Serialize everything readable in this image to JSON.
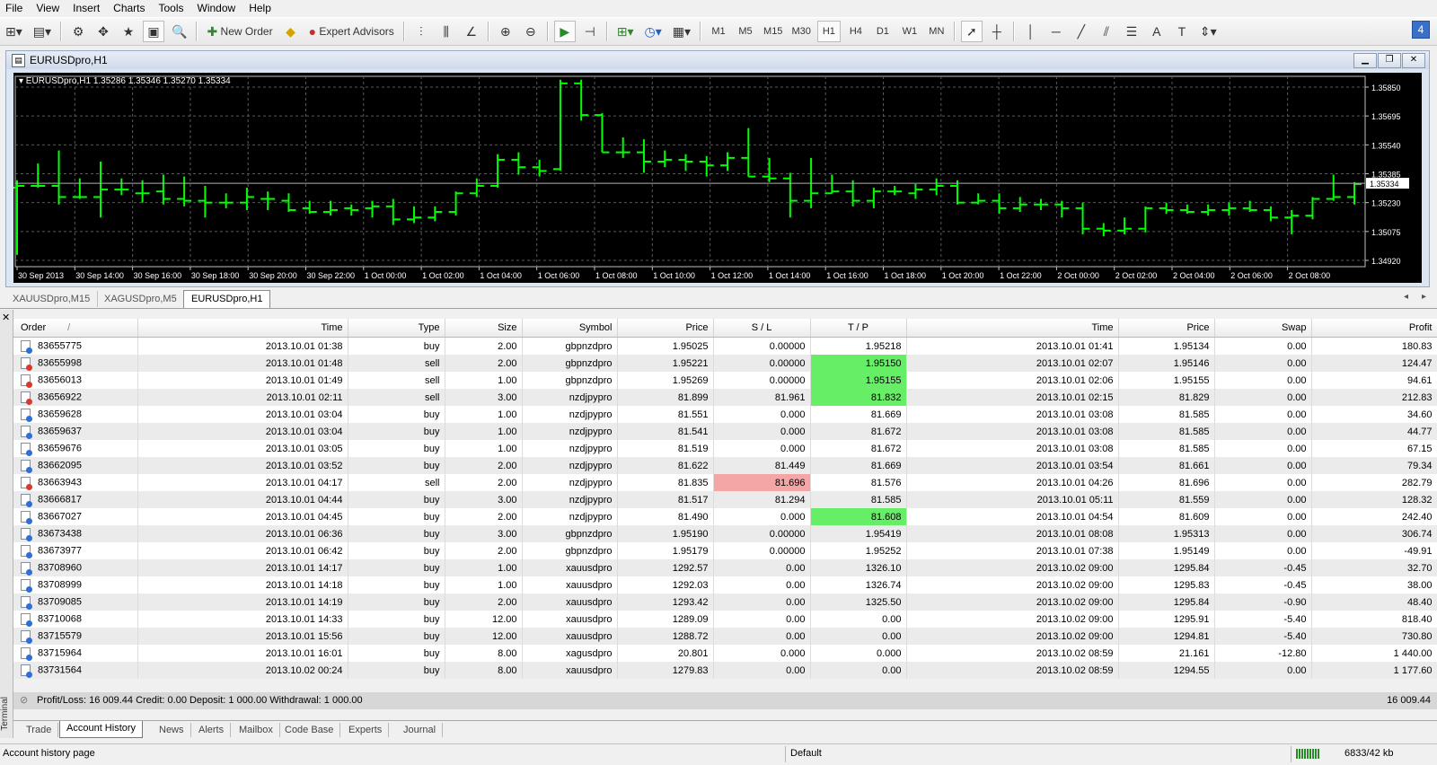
{
  "menu": [
    "File",
    "View",
    "Insert",
    "Charts",
    "Tools",
    "Window",
    "Help"
  ],
  "toolbar": {
    "new_order": "New Order",
    "expert_advisors": "Expert Advisors",
    "timeframes": [
      "M1",
      "M5",
      "M15",
      "M30",
      "H1",
      "H4",
      "D1",
      "W1",
      "MN"
    ],
    "active_timeframe": "H1"
  },
  "chart_window": {
    "title": "EURUSDpro,H1",
    "info": "EURUSDpro,H1  1.35286 1.35346 1.35270 1.35334",
    "current_price_label": "1.35334"
  },
  "chart_data": {
    "type": "bar",
    "ylim": [
      1.3492,
      1.3591
    ],
    "yticks": [
      "1.35850",
      "1.35695",
      "1.35540",
      "1.35385",
      "1.35230",
      "1.35075",
      "1.34920"
    ],
    "ytick_values": [
      1.3585,
      1.35695,
      1.3554,
      1.35385,
      1.3523,
      1.35075,
      1.3492
    ],
    "xticks": [
      "30 Sep 2013",
      "30 Sep 14:00",
      "30 Sep 16:00",
      "30 Sep 18:00",
      "30 Sep 20:00",
      "30 Sep 22:00",
      "1 Oct 00:00",
      "1 Oct 02:00",
      "1 Oct 04:00",
      "1 Oct 06:00",
      "1 Oct 08:00",
      "1 Oct 10:00",
      "1 Oct 12:00",
      "1 Oct 14:00",
      "1 Oct 16:00",
      "1 Oct 18:00",
      "1 Oct 20:00",
      "1 Oct 22:00",
      "2 Oct 00:00",
      "2 Oct 02:00",
      "2 Oct 04:00",
      "2 Oct 06:00",
      "2 Oct 08:00"
    ],
    "current_price": 1.35334,
    "ohlc": [
      [
        1.3531,
        1.3535,
        1.3495,
        1.3532
      ],
      [
        1.3532,
        1.3544,
        1.3531,
        1.3532
      ],
      [
        1.3532,
        1.3551,
        1.3522,
        1.3526
      ],
      [
        1.3526,
        1.3536,
        1.3525,
        1.3526
      ],
      [
        1.3526,
        1.3545,
        1.3515,
        1.353
      ],
      [
        1.353,
        1.3536,
        1.3527,
        1.353
      ],
      [
        1.3528,
        1.3535,
        1.3523,
        1.3528
      ],
      [
        1.3529,
        1.3538,
        1.3522,
        1.3525
      ],
      [
        1.3525,
        1.3537,
        1.3521,
        1.3524
      ],
      [
        1.3524,
        1.3532,
        1.3515,
        1.3523
      ],
      [
        1.3523,
        1.3528,
        1.352,
        1.3523
      ],
      [
        1.3523,
        1.3531,
        1.3519,
        1.3526
      ],
      [
        1.3525,
        1.3529,
        1.3519,
        1.3525
      ],
      [
        1.3524,
        1.3528,
        1.3518,
        1.3519
      ],
      [
        1.352,
        1.3524,
        1.3517,
        1.3518
      ],
      [
        1.3518,
        1.3524,
        1.3516,
        1.3519
      ],
      [
        1.352,
        1.3522,
        1.3516,
        1.3519
      ],
      [
        1.352,
        1.3524,
        1.3515,
        1.3521
      ],
      [
        1.3521,
        1.3525,
        1.3511,
        1.3514
      ],
      [
        1.3514,
        1.3521,
        1.3512,
        1.3515
      ],
      [
        1.3515,
        1.3521,
        1.3513,
        1.3518
      ],
      [
        1.3518,
        1.3529,
        1.3516,
        1.3528
      ],
      [
        1.3528,
        1.3536,
        1.3526,
        1.3532
      ],
      [
        1.3532,
        1.3549,
        1.3531,
        1.3546
      ],
      [
        1.3546,
        1.355,
        1.3538,
        1.3542
      ],
      [
        1.3542,
        1.3546,
        1.3537,
        1.354
      ],
      [
        1.3541,
        1.3589,
        1.354,
        1.3587
      ],
      [
        1.3587,
        1.3589,
        1.3567,
        1.357
      ],
      [
        1.357,
        1.3571,
        1.355,
        1.355
      ],
      [
        1.355,
        1.3558,
        1.3547,
        1.355
      ],
      [
        1.355,
        1.3557,
        1.3539,
        1.3545
      ],
      [
        1.3545,
        1.3551,
        1.3542,
        1.3546
      ],
      [
        1.3546,
        1.3549,
        1.354,
        1.3545
      ],
      [
        1.3545,
        1.3548,
        1.3537,
        1.3543
      ],
      [
        1.3543,
        1.355,
        1.354,
        1.3547
      ],
      [
        1.3547,
        1.3563,
        1.3537,
        1.3537
      ],
      [
        1.3537,
        1.3547,
        1.3534,
        1.3536
      ],
      [
        1.3536,
        1.3539,
        1.3515,
        1.3524
      ],
      [
        1.3524,
        1.3547,
        1.352,
        1.3528
      ],
      [
        1.3528,
        1.3538,
        1.3528,
        1.3529
      ],
      [
        1.3529,
        1.3535,
        1.3521,
        1.3524
      ],
      [
        1.3524,
        1.3531,
        1.352,
        1.3529
      ],
      [
        1.3529,
        1.3532,
        1.3527,
        1.3529
      ],
      [
        1.3528,
        1.3533,
        1.3525,
        1.353
      ],
      [
        1.353,
        1.3536,
        1.3527,
        1.3532
      ],
      [
        1.3532,
        1.3535,
        1.3522,
        1.3523
      ],
      [
        1.3523,
        1.3528,
        1.3522,
        1.3524
      ],
      [
        1.3524,
        1.3528,
        1.3517,
        1.352
      ],
      [
        1.352,
        1.3526,
        1.3518,
        1.3522
      ],
      [
        1.3522,
        1.3525,
        1.3519,
        1.3522
      ],
      [
        1.3522,
        1.3524,
        1.3515,
        1.352
      ],
      [
        1.352,
        1.3523,
        1.3506,
        1.3509
      ],
      [
        1.3509,
        1.3512,
        1.3505,
        1.3508
      ],
      [
        1.3508,
        1.3515,
        1.3506,
        1.3509
      ],
      [
        1.3509,
        1.3521,
        1.3507,
        1.352
      ],
      [
        1.352,
        1.3523,
        1.3517,
        1.3519
      ],
      [
        1.3519,
        1.3522,
        1.3517,
        1.3518
      ],
      [
        1.3518,
        1.3522,
        1.3516,
        1.3519
      ],
      [
        1.3519,
        1.3523,
        1.3516,
        1.352
      ],
      [
        1.352,
        1.3524,
        1.3518,
        1.3519
      ],
      [
        1.3519,
        1.3521,
        1.3513,
        1.3515
      ],
      [
        1.3515,
        1.3519,
        1.3506,
        1.3516
      ],
      [
        1.3516,
        1.3526,
        1.3514,
        1.3525
      ],
      [
        1.3525,
        1.3538,
        1.3524,
        1.3526
      ],
      [
        1.3526,
        1.3534,
        1.3522,
        1.3533
      ]
    ]
  },
  "chart_tabs": [
    "XAUUSDpro,M15",
    "XAGUSDpro,M5",
    "EURUSDpro,H1"
  ],
  "selected_chart_tab": "EURUSDpro,H1",
  "terminal": {
    "side_label": "Terminal",
    "columns": [
      "Order",
      "Time",
      "Type",
      "Size",
      "Symbol",
      "Price",
      "S / L",
      "T / P",
      "Time",
      "Price",
      "Swap",
      "Profit"
    ],
    "sort_mark": "/",
    "rows": [
      {
        "type_icon": "buy",
        "cells": [
          "83655775",
          "2013.10.01 01:38",
          "buy",
          "2.00",
          "gbpnzdpro",
          "1.95025",
          "0.00000",
          "1.95218",
          "2013.10.01 01:41",
          "1.95134",
          "0.00",
          "180.83"
        ],
        "hl": {}
      },
      {
        "type_icon": "sell",
        "cells": [
          "83655998",
          "2013.10.01 01:48",
          "sell",
          "2.00",
          "gbpnzdpro",
          "1.95221",
          "0.00000",
          "1.95150",
          "2013.10.01 02:07",
          "1.95146",
          "0.00",
          "124.47"
        ],
        "hl": {
          "tp": "green"
        }
      },
      {
        "type_icon": "sell",
        "cells": [
          "83656013",
          "2013.10.01 01:49",
          "sell",
          "1.00",
          "gbpnzdpro",
          "1.95269",
          "0.00000",
          "1.95155",
          "2013.10.01 02:06",
          "1.95155",
          "0.00",
          "94.61"
        ],
        "hl": {
          "tp": "green"
        }
      },
      {
        "type_icon": "sell",
        "cells": [
          "83656922",
          "2013.10.01 02:11",
          "sell",
          "3.00",
          "nzdjpypro",
          "81.899",
          "81.961",
          "81.832",
          "2013.10.01 02:15",
          "81.829",
          "0.00",
          "212.83"
        ],
        "hl": {
          "tp": "green"
        }
      },
      {
        "type_icon": "buy",
        "cells": [
          "83659628",
          "2013.10.01 03:04",
          "buy",
          "1.00",
          "nzdjpypro",
          "81.551",
          "0.000",
          "81.669",
          "2013.10.01 03:08",
          "81.585",
          "0.00",
          "34.60"
        ],
        "hl": {}
      },
      {
        "type_icon": "buy",
        "cells": [
          "83659637",
          "2013.10.01 03:04",
          "buy",
          "1.00",
          "nzdjpypro",
          "81.541",
          "0.000",
          "81.672",
          "2013.10.01 03:08",
          "81.585",
          "0.00",
          "44.77"
        ],
        "hl": {}
      },
      {
        "type_icon": "buy",
        "cells": [
          "83659676",
          "2013.10.01 03:05",
          "buy",
          "1.00",
          "nzdjpypro",
          "81.519",
          "0.000",
          "81.672",
          "2013.10.01 03:08",
          "81.585",
          "0.00",
          "67.15"
        ],
        "hl": {}
      },
      {
        "type_icon": "buy",
        "cells": [
          "83662095",
          "2013.10.01 03:52",
          "buy",
          "2.00",
          "nzdjpypro",
          "81.622",
          "81.449",
          "81.669",
          "2013.10.01 03:54",
          "81.661",
          "0.00",
          "79.34"
        ],
        "hl": {}
      },
      {
        "type_icon": "sell",
        "cells": [
          "83663943",
          "2013.10.01 04:17",
          "sell",
          "2.00",
          "nzdjpypro",
          "81.835",
          "81.696",
          "81.576",
          "2013.10.01 04:26",
          "81.696",
          "0.00",
          "282.79"
        ],
        "hl": {
          "sl": "red"
        }
      },
      {
        "type_icon": "buy",
        "cells": [
          "83666817",
          "2013.10.01 04:44",
          "buy",
          "3.00",
          "nzdjpypro",
          "81.517",
          "81.294",
          "81.585",
          "2013.10.01 05:11",
          "81.559",
          "0.00",
          "128.32"
        ],
        "hl": {}
      },
      {
        "type_icon": "buy",
        "cells": [
          "83667027",
          "2013.10.01 04:45",
          "buy",
          "2.00",
          "nzdjpypro",
          "81.490",
          "0.000",
          "81.608",
          "2013.10.01 04:54",
          "81.609",
          "0.00",
          "242.40"
        ],
        "hl": {
          "tp": "green"
        }
      },
      {
        "type_icon": "buy",
        "cells": [
          "83673438",
          "2013.10.01 06:36",
          "buy",
          "3.00",
          "gbpnzdpro",
          "1.95190",
          "0.00000",
          "1.95419",
          "2013.10.01 08:08",
          "1.95313",
          "0.00",
          "306.74"
        ],
        "hl": {}
      },
      {
        "type_icon": "buy",
        "cells": [
          "83673977",
          "2013.10.01 06:42",
          "buy",
          "2.00",
          "gbpnzdpro",
          "1.95179",
          "0.00000",
          "1.95252",
          "2013.10.01 07:38",
          "1.95149",
          "0.00",
          "-49.91"
        ],
        "hl": {}
      },
      {
        "type_icon": "buy",
        "cells": [
          "83708960",
          "2013.10.01 14:17",
          "buy",
          "1.00",
          "xauusdpro",
          "1292.57",
          "0.00",
          "1326.10",
          "2013.10.02 09:00",
          "1295.84",
          "-0.45",
          "32.70"
        ],
        "hl": {}
      },
      {
        "type_icon": "buy",
        "cells": [
          "83708999",
          "2013.10.01 14:18",
          "buy",
          "1.00",
          "xauusdpro",
          "1292.03",
          "0.00",
          "1326.74",
          "2013.10.02 09:00",
          "1295.83",
          "-0.45",
          "38.00"
        ],
        "hl": {}
      },
      {
        "type_icon": "buy",
        "cells": [
          "83709085",
          "2013.10.01 14:19",
          "buy",
          "2.00",
          "xauusdpro",
          "1293.42",
          "0.00",
          "1325.50",
          "2013.10.02 09:00",
          "1295.84",
          "-0.90",
          "48.40"
        ],
        "hl": {}
      },
      {
        "type_icon": "buy",
        "cells": [
          "83710068",
          "2013.10.01 14:33",
          "buy",
          "12.00",
          "xauusdpro",
          "1289.09",
          "0.00",
          "0.00",
          "2013.10.02 09:00",
          "1295.91",
          "-5.40",
          "818.40"
        ],
        "hl": {}
      },
      {
        "type_icon": "buy",
        "cells": [
          "83715579",
          "2013.10.01 15:56",
          "buy",
          "12.00",
          "xauusdpro",
          "1288.72",
          "0.00",
          "0.00",
          "2013.10.02 09:00",
          "1294.81",
          "-5.40",
          "730.80"
        ],
        "hl": {}
      },
      {
        "type_icon": "buy",
        "cells": [
          "83715964",
          "2013.10.01 16:01",
          "buy",
          "8.00",
          "xagusdpro",
          "20.801",
          "0.000",
          "0.000",
          "2013.10.02 08:59",
          "21.161",
          "-12.80",
          "1 440.00"
        ],
        "hl": {}
      },
      {
        "type_icon": "buy",
        "cells": [
          "83731564",
          "2013.10.02 00:24",
          "buy",
          "8.00",
          "xauusdpro",
          "1279.83",
          "0.00",
          "0.00",
          "2013.10.02 08:59",
          "1294.55",
          "0.00",
          "1 177.60"
        ],
        "hl": {}
      }
    ],
    "summary": "Profit/Loss: 16 009.44 Credit: 0.00 Deposit: 1 000.00 Withdrawal: 1 000.00",
    "summary_total": "16 009.44",
    "tabs": [
      "Trade",
      "Account History",
      "News",
      "Alerts",
      "Mailbox",
      "Code Base",
      "Experts",
      "Journal"
    ],
    "selected_tab": "Account History"
  },
  "status": {
    "hint": "Account history page",
    "profile": "Default",
    "traffic": "6833/42 kb"
  },
  "colors": {
    "bull": "#00ff00",
    "grid": "#5a5a5a",
    "tp_hit": "#66ee66",
    "sl_hit": "#f4a6a6"
  }
}
